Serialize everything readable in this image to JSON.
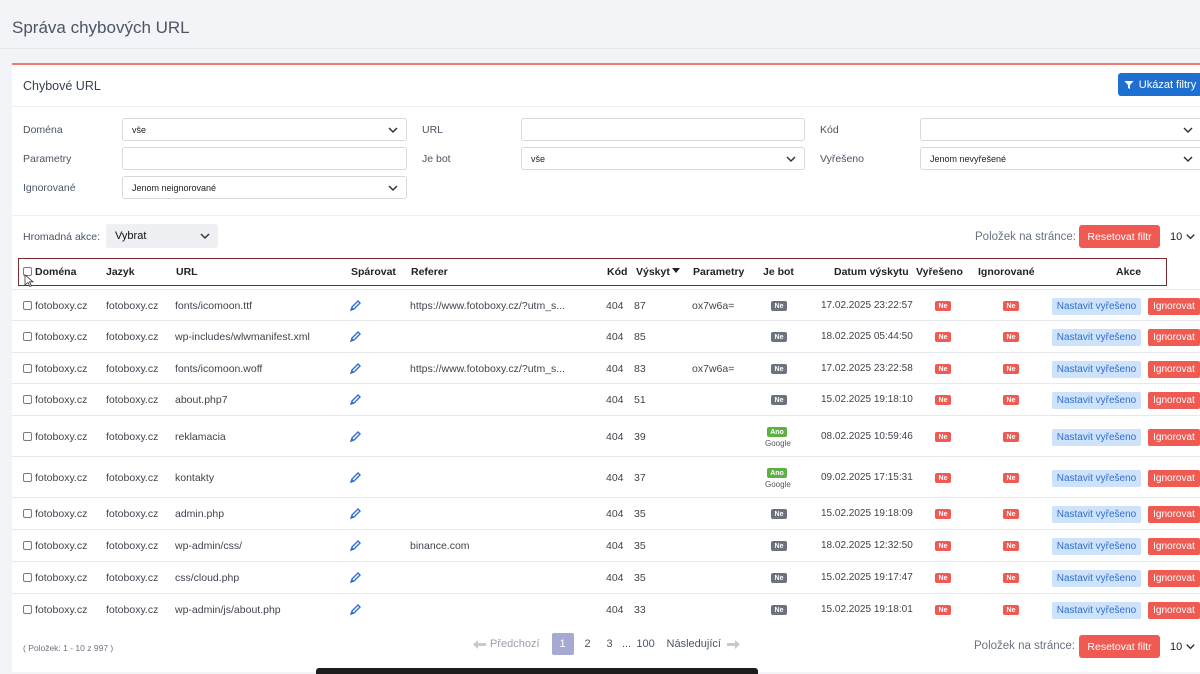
{
  "page": {
    "title": "Správa chybových URL"
  },
  "panel": {
    "title": "Chybové URL",
    "filters_button": "Ukázat filtry"
  },
  "filters": {
    "domain": {
      "label": "Doména",
      "value": "vše"
    },
    "url": {
      "label": "URL",
      "value": ""
    },
    "code": {
      "label": "Kód",
      "value": ""
    },
    "params": {
      "label": "Parametry",
      "value": ""
    },
    "bot": {
      "label": "Je bot",
      "value": "vše"
    },
    "solved": {
      "label": "Vyřešeno",
      "value": "Jenom nevyřešené"
    },
    "ignored": {
      "label": "Ignorované",
      "value": "Jenom neignorované"
    }
  },
  "toolbar": {
    "bulk_label": "Hromadná akce:",
    "bulk_value": "Vybrat",
    "per_page_label": "Položek na stránce:",
    "reset_button": "Resetovat filtr",
    "per_page_value": "10"
  },
  "columns": {
    "domain": "Doména",
    "lang": "Jazyk",
    "url": "URL",
    "pair": "Spárovat",
    "referer": "Referer",
    "code": "Kód",
    "count": "Výskyt",
    "params": "Parametry",
    "bot": "Je bot",
    "date": "Datum výskytu",
    "solved": "Vyřešeno",
    "ignored": "Ignorované",
    "actions": "Akce"
  },
  "row_labels": {
    "bot_no": "Ne",
    "bot_yes": "Ano",
    "solved_no": "Ne",
    "ignored_no": "Ne",
    "solve_action": "Nastavit vyřešeno",
    "ignore_action": "Ignorovat"
  },
  "rows": [
    {
      "domain": "fotoboxy.cz",
      "lang": "fotoboxy.cz",
      "url": "fonts/icomoon.ttf",
      "referer": "https://www.fotoboxy.cz/?utm_s...",
      "code": "404",
      "count": "87",
      "params": "ox7w6a=",
      "bot": "Ne",
      "bot_sub": "",
      "date": "17.02.2025 23:22:57"
    },
    {
      "domain": "fotoboxy.cz",
      "lang": "fotoboxy.cz",
      "url": "wp-includes/wlwmanifest.xml",
      "referer": "",
      "code": "404",
      "count": "85",
      "params": "",
      "bot": "Ne",
      "bot_sub": "",
      "date": "18.02.2025 05:44:50"
    },
    {
      "domain": "fotoboxy.cz",
      "lang": "fotoboxy.cz",
      "url": "fonts/icomoon.woff",
      "referer": "https://www.fotoboxy.cz/?utm_s...",
      "code": "404",
      "count": "83",
      "params": "ox7w6a=",
      "bot": "Ne",
      "bot_sub": "",
      "date": "17.02.2025 23:22:58"
    },
    {
      "domain": "fotoboxy.cz",
      "lang": "fotoboxy.cz",
      "url": "about.php7",
      "referer": "",
      "code": "404",
      "count": "51",
      "params": "",
      "bot": "Ne",
      "bot_sub": "",
      "date": "15.02.2025 19:18:10"
    },
    {
      "domain": "fotoboxy.cz",
      "lang": "fotoboxy.cz",
      "url": "reklamacia",
      "referer": "",
      "code": "404",
      "count": "39",
      "params": "",
      "bot": "Ano",
      "bot_sub": "Google",
      "date": "08.02.2025 10:59:46"
    },
    {
      "domain": "fotoboxy.cz",
      "lang": "fotoboxy.cz",
      "url": "kontakty",
      "referer": "",
      "code": "404",
      "count": "37",
      "params": "",
      "bot": "Ano",
      "bot_sub": "Google",
      "date": "09.02.2025 17:15:31"
    },
    {
      "domain": "fotoboxy.cz",
      "lang": "fotoboxy.cz",
      "url": "admin.php",
      "referer": "",
      "code": "404",
      "count": "35",
      "params": "",
      "bot": "Ne",
      "bot_sub": "",
      "date": "15.02.2025 19:18:09"
    },
    {
      "domain": "fotoboxy.cz",
      "lang": "fotoboxy.cz",
      "url": "wp-admin/css/",
      "referer": "binance.com",
      "code": "404",
      "count": "35",
      "params": "",
      "bot": "Ne",
      "bot_sub": "",
      "date": "18.02.2025 12:32:50"
    },
    {
      "domain": "fotoboxy.cz",
      "lang": "fotoboxy.cz",
      "url": "css/cloud.php",
      "referer": "",
      "code": "404",
      "count": "35",
      "params": "",
      "bot": "Ne",
      "bot_sub": "",
      "date": "15.02.2025 19:17:47"
    },
    {
      "domain": "fotoboxy.cz",
      "lang": "fotoboxy.cz",
      "url": "wp-admin/js/about.php",
      "referer": "",
      "code": "404",
      "count": "33",
      "params": "",
      "bot": "Ne",
      "bot_sub": "",
      "date": "15.02.2025 19:18:01"
    }
  ],
  "footer": {
    "info": "( Položek: 1 - 10 z 997 )",
    "prev": "Předchozí",
    "pages": [
      "1",
      "2",
      "3",
      "...",
      "100"
    ],
    "next": "Následující",
    "per_page_label": "Položek na stránce:",
    "reset_button": "Resetovat filtr",
    "per_page_value": "10"
  },
  "colors": {
    "primary": "#1f6fd1",
    "danger": "#ef5b52",
    "accent_line": "#ef7b72",
    "light_blue": "#cfe2fb",
    "bot_yes": "#5fb043"
  }
}
